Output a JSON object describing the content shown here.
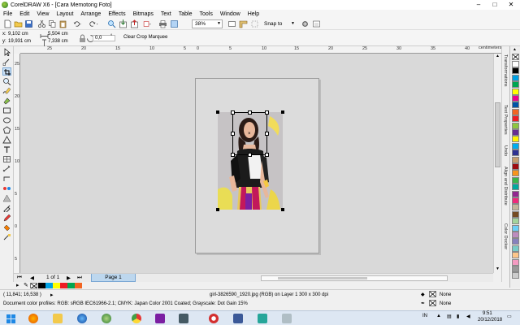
{
  "window": {
    "title": "CorelDRAW X6 - [Cara Memotong Foto]",
    "minimize": "–",
    "maximize": "□",
    "close": "✕"
  },
  "menu": [
    "File",
    "Edit",
    "View",
    "Layout",
    "Arrange",
    "Effects",
    "Bitmaps",
    "Text",
    "Table",
    "Tools",
    "Window",
    "Help"
  ],
  "toolbar": {
    "zoom": "38%",
    "snap_to": "Snap to"
  },
  "property_bar": {
    "x_label": "x:",
    "x_value": "9,102 cm",
    "y_label": "y:",
    "y_value": "19,931 cm",
    "w_value": "5,504 cm",
    "h_value": "7,338 cm",
    "angle_value": "0,0",
    "angle_unit": "°",
    "clear_crop": "Clear Crop Marquee"
  },
  "rulers": {
    "top_labels": [
      "25",
      "20",
      "15",
      "10",
      "5",
      "0",
      "5",
      "10",
      "15",
      "20",
      "25",
      "30",
      "35",
      "40"
    ],
    "unit": "centimeters",
    "left_labels": [
      "25",
      "20",
      "15",
      "10",
      "5",
      "0",
      "5"
    ]
  },
  "dockers": [
    "Transformations",
    "Text Properties",
    "Undo",
    "Align and Distribute",
    "Color Docker"
  ],
  "palette": {
    "colors": [
      "#ffffff",
      "#000000",
      "#00a0e3",
      "#00a651",
      "#ffff00",
      "#ec008c",
      "#0054a6",
      "#f26522",
      "#ed1c24",
      "#8dc63f",
      "#662d91",
      "#fff200",
      "#00aeef",
      "#2e3192",
      "#c69c6d",
      "#9e0b0f",
      "#f7941d",
      "#39b54a",
      "#00a99d",
      "#92278f",
      "#ee2a7b",
      "#c2b59b",
      "#754c24",
      "#a3d39c",
      "#6dcff6",
      "#bd8cbf",
      "#8781bd",
      "#7accc8",
      "#fdc689",
      "#f49ac1",
      "#999999",
      "#cccccc"
    ]
  },
  "page_nav": {
    "counter": "1 of 1",
    "page_tab": "Page 1"
  },
  "doc_palette": [
    "#000000",
    "#00a0e3",
    "#ffff00",
    "#ed1c24",
    "#00a651",
    "#f26522"
  ],
  "status": {
    "coords": "( 11,841; 16,538 )",
    "object_info": "girl-3826590_1920.jpg (RGB) on Layer 1 300 x 300 dpi",
    "profiles": "Document color profiles: RGB: sRGB IEC61966-2.1; CMYK: Japan Color 2001 Coated; Grayscale: Dot Gain 15%",
    "fill": "None",
    "outline": "None"
  },
  "taskbar": {
    "lang": "IN",
    "time": "9:51",
    "date": "20/12/2018"
  },
  "crop_center_glyph": "×"
}
